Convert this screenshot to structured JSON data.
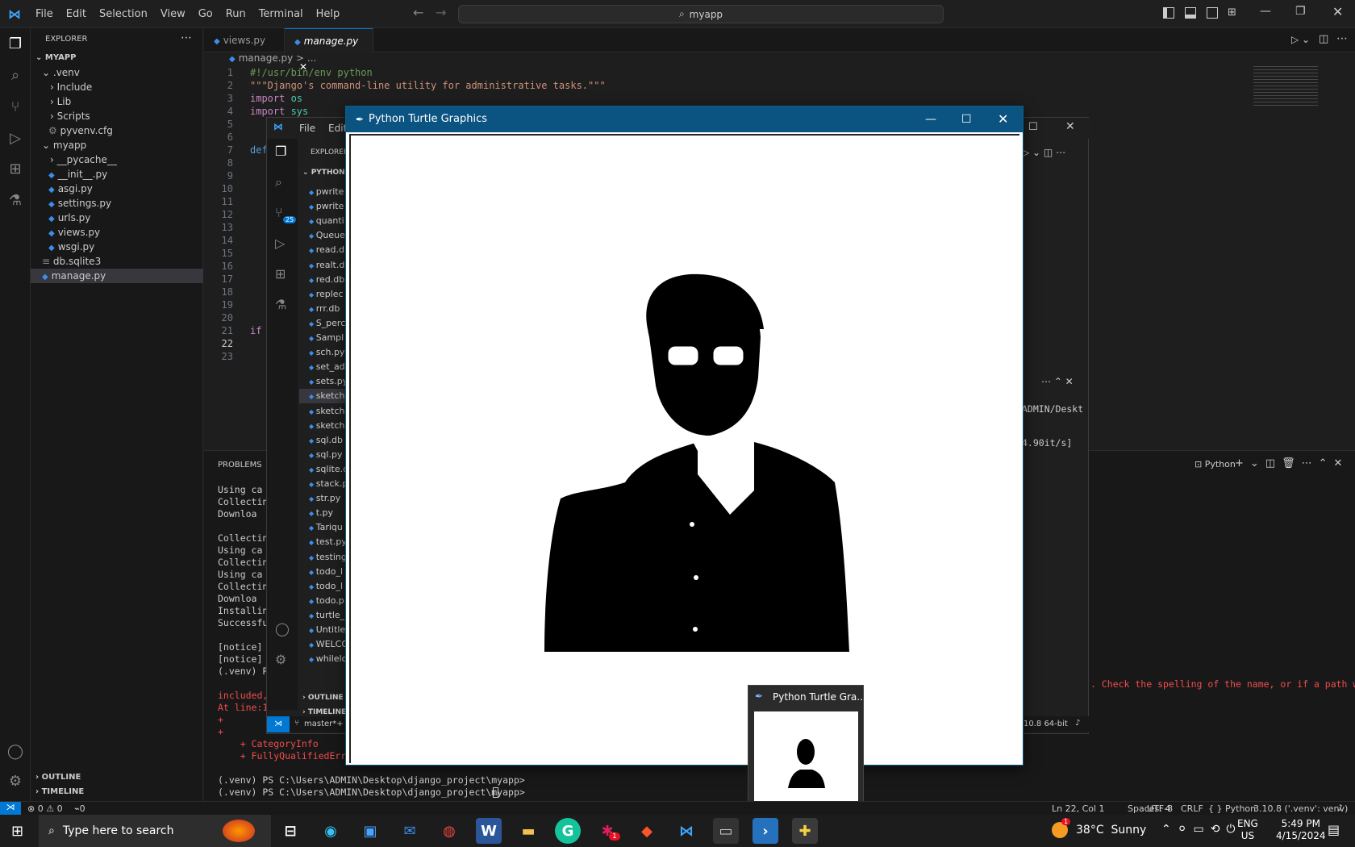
{
  "menu": [
    "File",
    "Edit",
    "Selection",
    "View",
    "Go",
    "Run",
    "Terminal",
    "Help"
  ],
  "search": "myapp",
  "explorer": {
    "header": "EXPLORER",
    "root": "MYAPP",
    "items": [
      ".venv",
      "Include",
      "Lib",
      "Scripts",
      "pyvenv.cfg",
      "myapp",
      "__pycache__",
      "__init__.py",
      "asgi.py",
      "settings.py",
      "urls.py",
      "views.py",
      "wsgi.py",
      "db.sqlite3",
      "manage.py"
    ],
    "outline": "OUTLINE",
    "timeline": "TIMELINE"
  },
  "tabs": [
    "views.py",
    "manage.py"
  ],
  "breadcrumb": "manage.py > ...",
  "code": {
    "l1": "#!/usr/bin/env python",
    "l2": "\"\"\"Django's command-line utility for administrative tasks.\"\"\"",
    "l3a": "import",
    "l3b": " os",
    "l4a": "import",
    "l4b": " sys",
    "l7": "def",
    "l21": "if"
  },
  "line_numbers": [
    "1",
    "2",
    "3",
    "4",
    "5",
    "6",
    "7",
    "8",
    "9",
    "10",
    "11",
    "12",
    "13",
    "14",
    "15",
    "16",
    "17",
    "18",
    "19",
    "20",
    "21",
    "22",
    "23"
  ],
  "panel": {
    "tab": "PROBLEMS",
    "shell": "Python"
  },
  "terminal": [
    "Using ca",
    "Collecting",
    "Downloa",
    "",
    "Collecting",
    "Using ca",
    "Collecting",
    "Using ca",
    "Collecting",
    "Downloa",
    "Installing",
    "Successful",
    "",
    "[notice] A",
    "[notice] T",
    "(.venv) PS",
    "",
    "included,",
    "At line:1",
    "+ ",
    "+ ",
    "    + CategoryInfo",
    "    + FullyQualifiedErrorI",
    "",
    "(.venv) PS C:\\Users\\ADMIN\\Desktop\\django_project\\myapp>",
    "(.venv) PS C:\\Users\\ADMIN\\Desktop\\django_project\\myapp> "
  ],
  "terminal_error_right": ". Check the spelling of the name, or if a path was",
  "win2": {
    "menu_file": "File",
    "menu_edit": "Edit",
    "explorer": "EXPLORER",
    "folder": "PYTHON",
    "badge": "25",
    "files": [
      "pwrite",
      "pwrite",
      "quanti",
      "Queue",
      "read.d",
      "realt.d",
      "red.db",
      "replec",
      "rrr.db",
      "S_perc",
      "Sampl",
      "sch.py",
      "set_ad",
      "sets.py",
      "sketch",
      "sketch",
      "sketch",
      "sql.db",
      "sql.py",
      "sqlite.d",
      "stack.p",
      "str.py",
      "t.py",
      "Tariqu",
      "test.py",
      "testing",
      "todo_l",
      "todo_l",
      "todo.p",
      "turtle_",
      "Untitle",
      "WELCO",
      "whilelo"
    ],
    "outline": "OUTLINE",
    "timeline": "TIMELINE",
    "branch": "master*+",
    "path_frag": "ADMIN/Deskt",
    "speed_frag": "4.90it/s]",
    "ver_frag": "10.8 64-bit"
  },
  "turtle": {
    "title": "Python Turtle Graphics"
  },
  "thumb": {
    "title": "Python Turtle Gra..."
  },
  "status": {
    "errors": "0",
    "warnings": "0",
    "ports": "0",
    "pos": "Ln 22, Col 1",
    "spaces": "Spaces: 4",
    "enc": "UTF-8",
    "eol": "CRLF",
    "lang": "Python",
    "interp": "3.10.8 ('.venv': venv)"
  },
  "taskbar": {
    "search": "Type here to search",
    "weather": "38°C  Sunny",
    "lang1": "ENG",
    "lang2": "US",
    "time": "5:49 PM",
    "date": "4/15/2024",
    "mail_badge": "1",
    "notif": "1"
  }
}
